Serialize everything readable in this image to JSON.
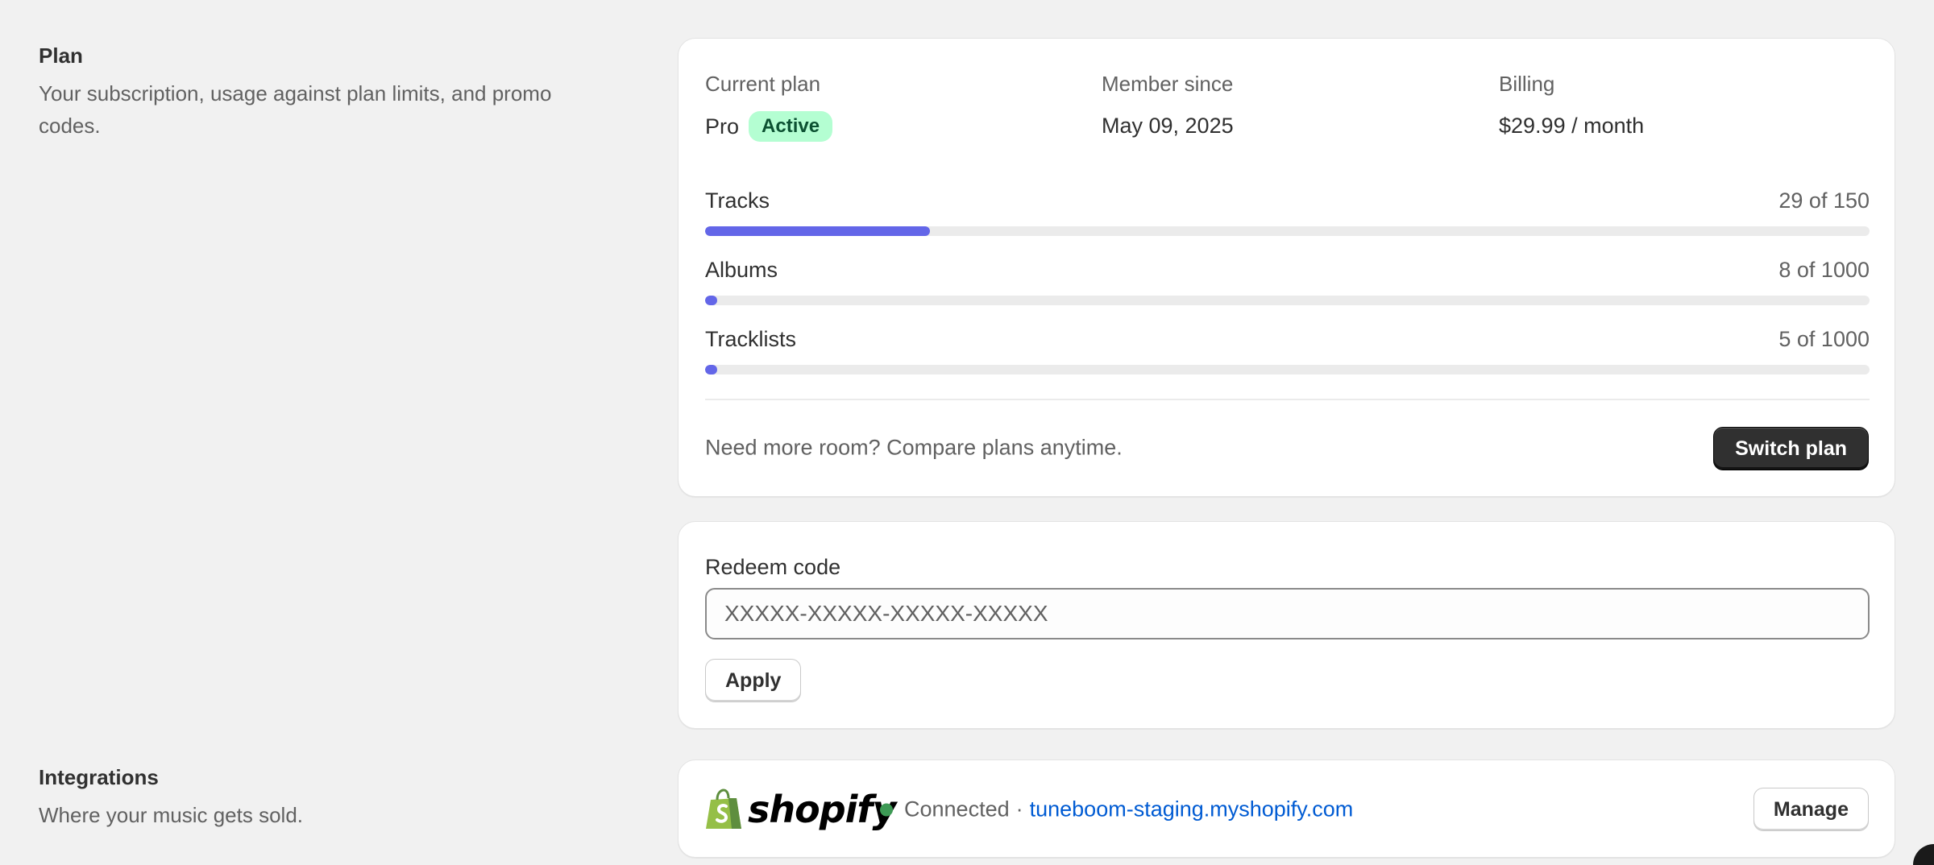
{
  "plan_section": {
    "title": "Plan",
    "description": "Your subscription, usage against plan limits, and promo codes."
  },
  "plan": {
    "current_label": "Current plan",
    "current_value": "Pro",
    "status_badge": "Active",
    "member_label": "Member since",
    "member_value": "May 09, 2025",
    "billing_label": "Billing",
    "billing_value": "$29.99 / month",
    "usage": [
      {
        "label": "Tracks",
        "count": "29 of 150",
        "used": 29,
        "limit": 150
      },
      {
        "label": "Albums",
        "count": "8 of 1000",
        "used": 8,
        "limit": 1000
      },
      {
        "label": "Tracklists",
        "count": "5 of 1000",
        "used": 5,
        "limit": 1000
      }
    ],
    "footer_note": "Need more room? Compare plans anytime.",
    "switch_label": "Switch plan"
  },
  "redeem": {
    "label": "Redeem code",
    "placeholder": "XXXXX-XXXXX-XXXXX-XXXXX",
    "apply_label": "Apply"
  },
  "integrations_section": {
    "title": "Integrations",
    "description": "Where your music gets sold."
  },
  "integration": {
    "brand": "shopify",
    "status": "Connected",
    "separator": "·",
    "store_url": "tuneboom-staging.myshopify.com",
    "manage_label": "Manage"
  },
  "colors": {
    "accent": "#6366e8",
    "badge_bg": "#b4fed2",
    "link": "#005bd3",
    "status_dot": "#3d9a55",
    "shopify_green": "#95bf47"
  }
}
